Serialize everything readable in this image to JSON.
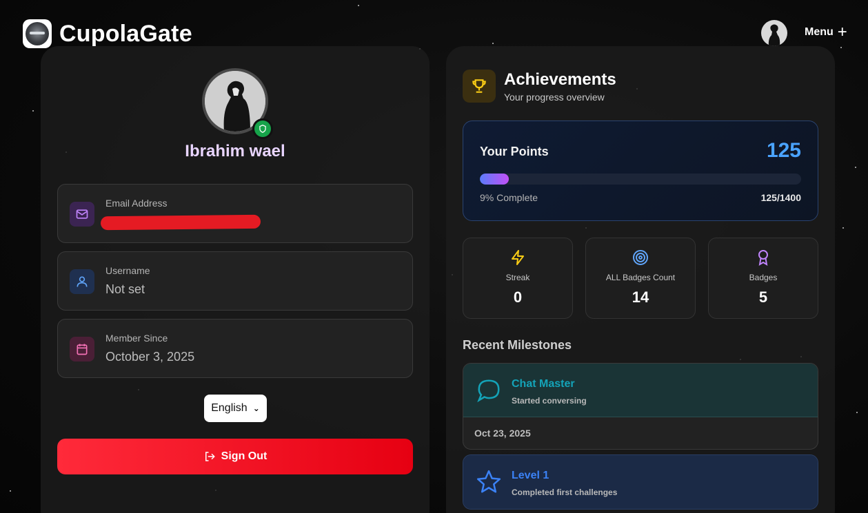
{
  "header": {
    "brand_name": "CupolaGate",
    "menu_label": "Menu",
    "menu_icon": "plus-icon"
  },
  "profile": {
    "name": "Ibrahim wael",
    "fields": [
      {
        "label": "Email Address",
        "value": "",
        "icon": "mail-icon",
        "color": "#c084fc"
      },
      {
        "label": "Username",
        "value": "Not set",
        "icon": "user-icon",
        "color": "#60a5fa"
      },
      {
        "label": "Member Since",
        "value": "October 3, 2025",
        "icon": "calendar-icon",
        "color": "#f472b6"
      }
    ],
    "language": "English",
    "sign_out_label": "Sign Out"
  },
  "achievements": {
    "title": "Achievements",
    "subtitle": "Your progress overview",
    "points": {
      "label": "Your Points",
      "value": "125",
      "percent_text": "9% Complete",
      "progress_fraction": 0.09,
      "fraction_text": "125/1400"
    },
    "stats": [
      {
        "label": "Streak",
        "value": "0",
        "icon": "lightning-icon",
        "color": "#facc15"
      },
      {
        "label": "ALL Badges Count",
        "value": "14",
        "icon": "target-icon",
        "color": "#60a5fa"
      },
      {
        "label": "Badges",
        "value": "5",
        "icon": "award-icon",
        "color": "#c084fc"
      }
    ],
    "recent_title": "Recent Milestones",
    "milestones": [
      {
        "title": "Chat Master",
        "desc": "Started conversing",
        "date": "Oct 23, 2025",
        "icon": "chat-icon",
        "color": "#14a3b8"
      },
      {
        "title": "Level 1",
        "desc": "Completed first challenges",
        "date": "",
        "icon": "star-icon",
        "color": "#3b82f6"
      }
    ]
  },
  "colors": {
    "accent_purple": "#e9d5ff",
    "points_blue": "#4aa3ff",
    "signout_red": "#ff2a3a",
    "verified_green": "#16a34a"
  }
}
